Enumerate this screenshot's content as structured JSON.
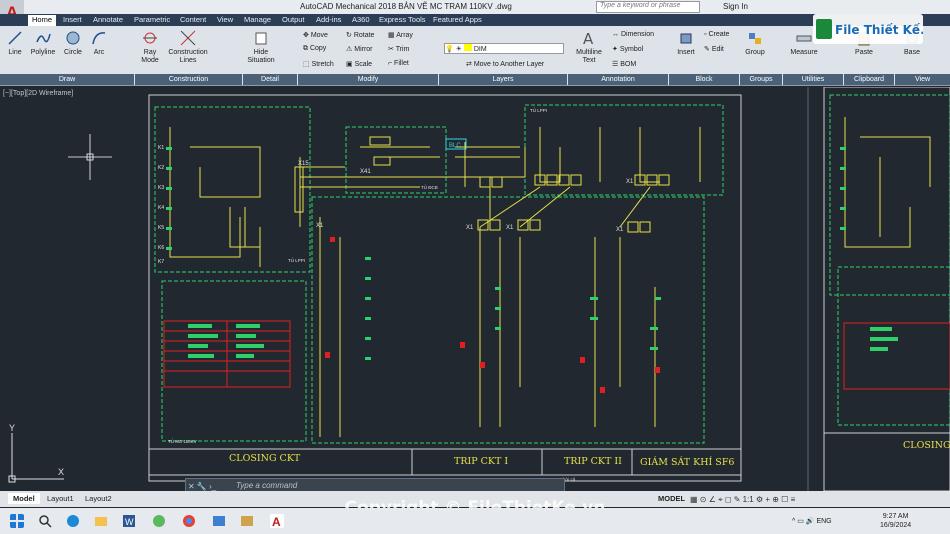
{
  "app": {
    "title": "AutoCAD Mechanical 2018   BẢN VẼ MC TRAM 110KV  .dwg",
    "search_placeholder": "Type a keyword or phrase",
    "signin": "Sign In",
    "logo_letter": "A"
  },
  "tabs": [
    "Home",
    "Insert",
    "Annotate",
    "Parametric",
    "Content",
    "View",
    "Manage",
    "Output",
    "Add-ins",
    "A360",
    "Express Tools",
    "Featured Apps"
  ],
  "ribbon": {
    "draw": [
      "Line",
      "Polyline",
      "Circle",
      "Arc"
    ],
    "ray": "Ray\nMode",
    "construction": "Construction\nLines",
    "hide": "Hide\nSituation",
    "modify": [
      "Move",
      "Rotate",
      "Array",
      "Copy",
      "Mirror",
      "Trim",
      "Stretch",
      "Scale",
      "Fillet"
    ],
    "layer_name": "DIM",
    "move_layer": "Move to Another Layer",
    "multiline": "Multiline\nText",
    "annotation": [
      "Dimension",
      "Symbol",
      "BOM"
    ],
    "insert": "Insert",
    "block": [
      "Create",
      "Edit"
    ],
    "group": "Group",
    "measure": "Measure",
    "paste": "Paste",
    "base": "Base",
    "panels": [
      "Draw",
      "Construction",
      "Detail",
      "Modify",
      "Layers",
      "Annotation",
      "Block",
      "Groups",
      "Utilities",
      "Clipboard",
      "View"
    ]
  },
  "viewport": {
    "label": "[−][Top][2D Wireframe]"
  },
  "drawing": {
    "sections": [
      "CLOSING CKT",
      "TRIP CKT I",
      "TRIP CKT II",
      "GIÁM SÁT KHÍ SF6"
    ],
    "right_section": "CLOSING",
    "small_labels": [
      "TỦ LPPI",
      "TỦ ĐCB",
      "TỦ LPPI",
      "TỦ MC 110KV",
      "Thời cả",
      "TỦ MC 110KV"
    ],
    "terminals": [
      "X1",
      "X1",
      "X1",
      "X41",
      "X15",
      "X1",
      "X1"
    ],
    "blc": "BLC",
    "device_labels": [
      "K1",
      "K2",
      "K3",
      "K4",
      "K5",
      "K6",
      "K7"
    ]
  },
  "command": {
    "placeholder": "Type a command"
  },
  "status": {
    "layouts": [
      "Model",
      "Layout1",
      "Layout2"
    ],
    "model": "MODEL"
  },
  "watermark": "Copyright © FileThietKe.vn",
  "brand": {
    "name": "File Thiết Kế.vn"
  },
  "taskbar": {
    "lang": "ENG",
    "time": "9:27 AM",
    "date": "16/9/2024"
  }
}
